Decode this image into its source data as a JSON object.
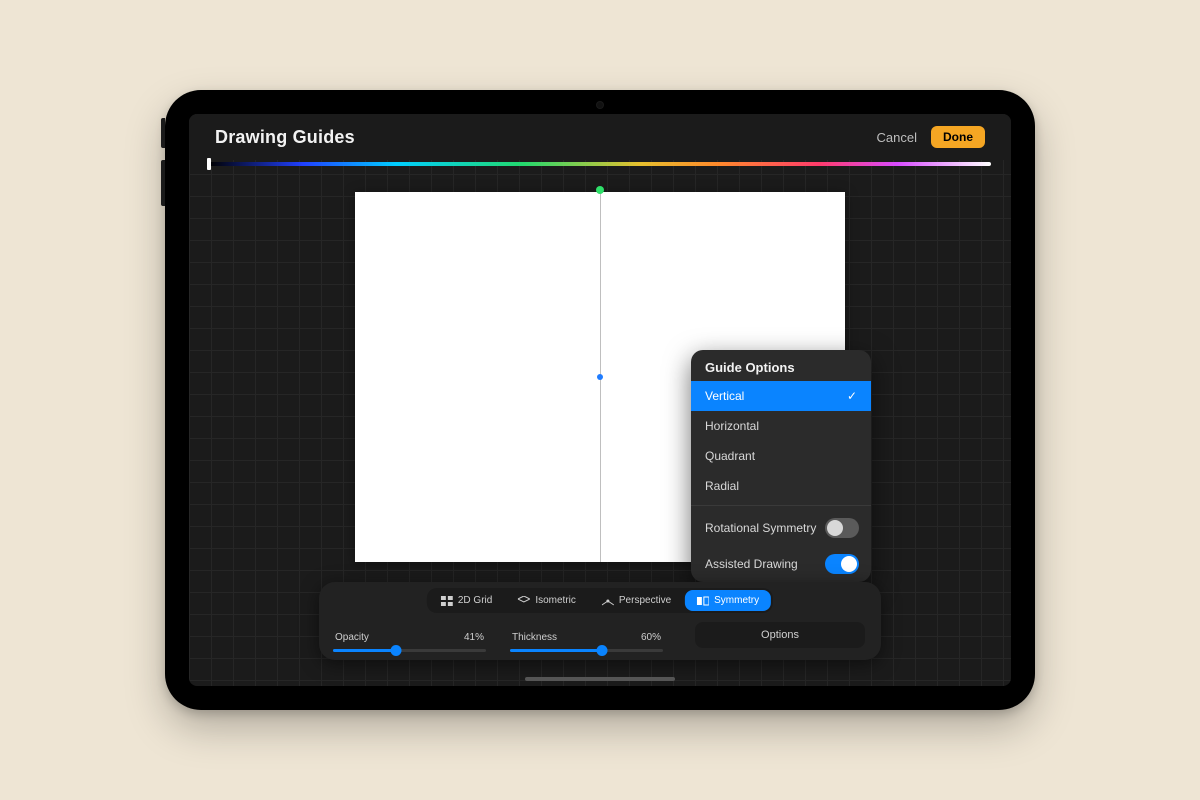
{
  "header": {
    "title": "Drawing Guides",
    "cancel_label": "Cancel",
    "done_label": "Done"
  },
  "guide_tabs": {
    "items": [
      {
        "label": "2D Grid",
        "icon": "grid",
        "active": false
      },
      {
        "label": "Isometric",
        "icon": "isometric",
        "active": false
      },
      {
        "label": "Perspective",
        "icon": "perspective",
        "active": false
      },
      {
        "label": "Symmetry",
        "icon": "symmetry",
        "active": true
      }
    ]
  },
  "sliders": {
    "opacity": {
      "label": "Opacity",
      "value_text": "41%",
      "value": 41
    },
    "thickness": {
      "label": "Thickness",
      "value_text": "60%",
      "value": 60
    }
  },
  "options_button_label": "Options",
  "popover": {
    "title": "Guide Options",
    "symmetry_types": [
      {
        "label": "Vertical",
        "selected": true
      },
      {
        "label": "Horizontal",
        "selected": false
      },
      {
        "label": "Quadrant",
        "selected": false
      },
      {
        "label": "Radial",
        "selected": false
      }
    ],
    "toggles": [
      {
        "label": "Rotational Symmetry",
        "on": false
      },
      {
        "label": "Assisted Drawing",
        "on": true
      }
    ]
  },
  "colors": {
    "accent": "#0a84ff",
    "done_bg": "#f5a623"
  }
}
